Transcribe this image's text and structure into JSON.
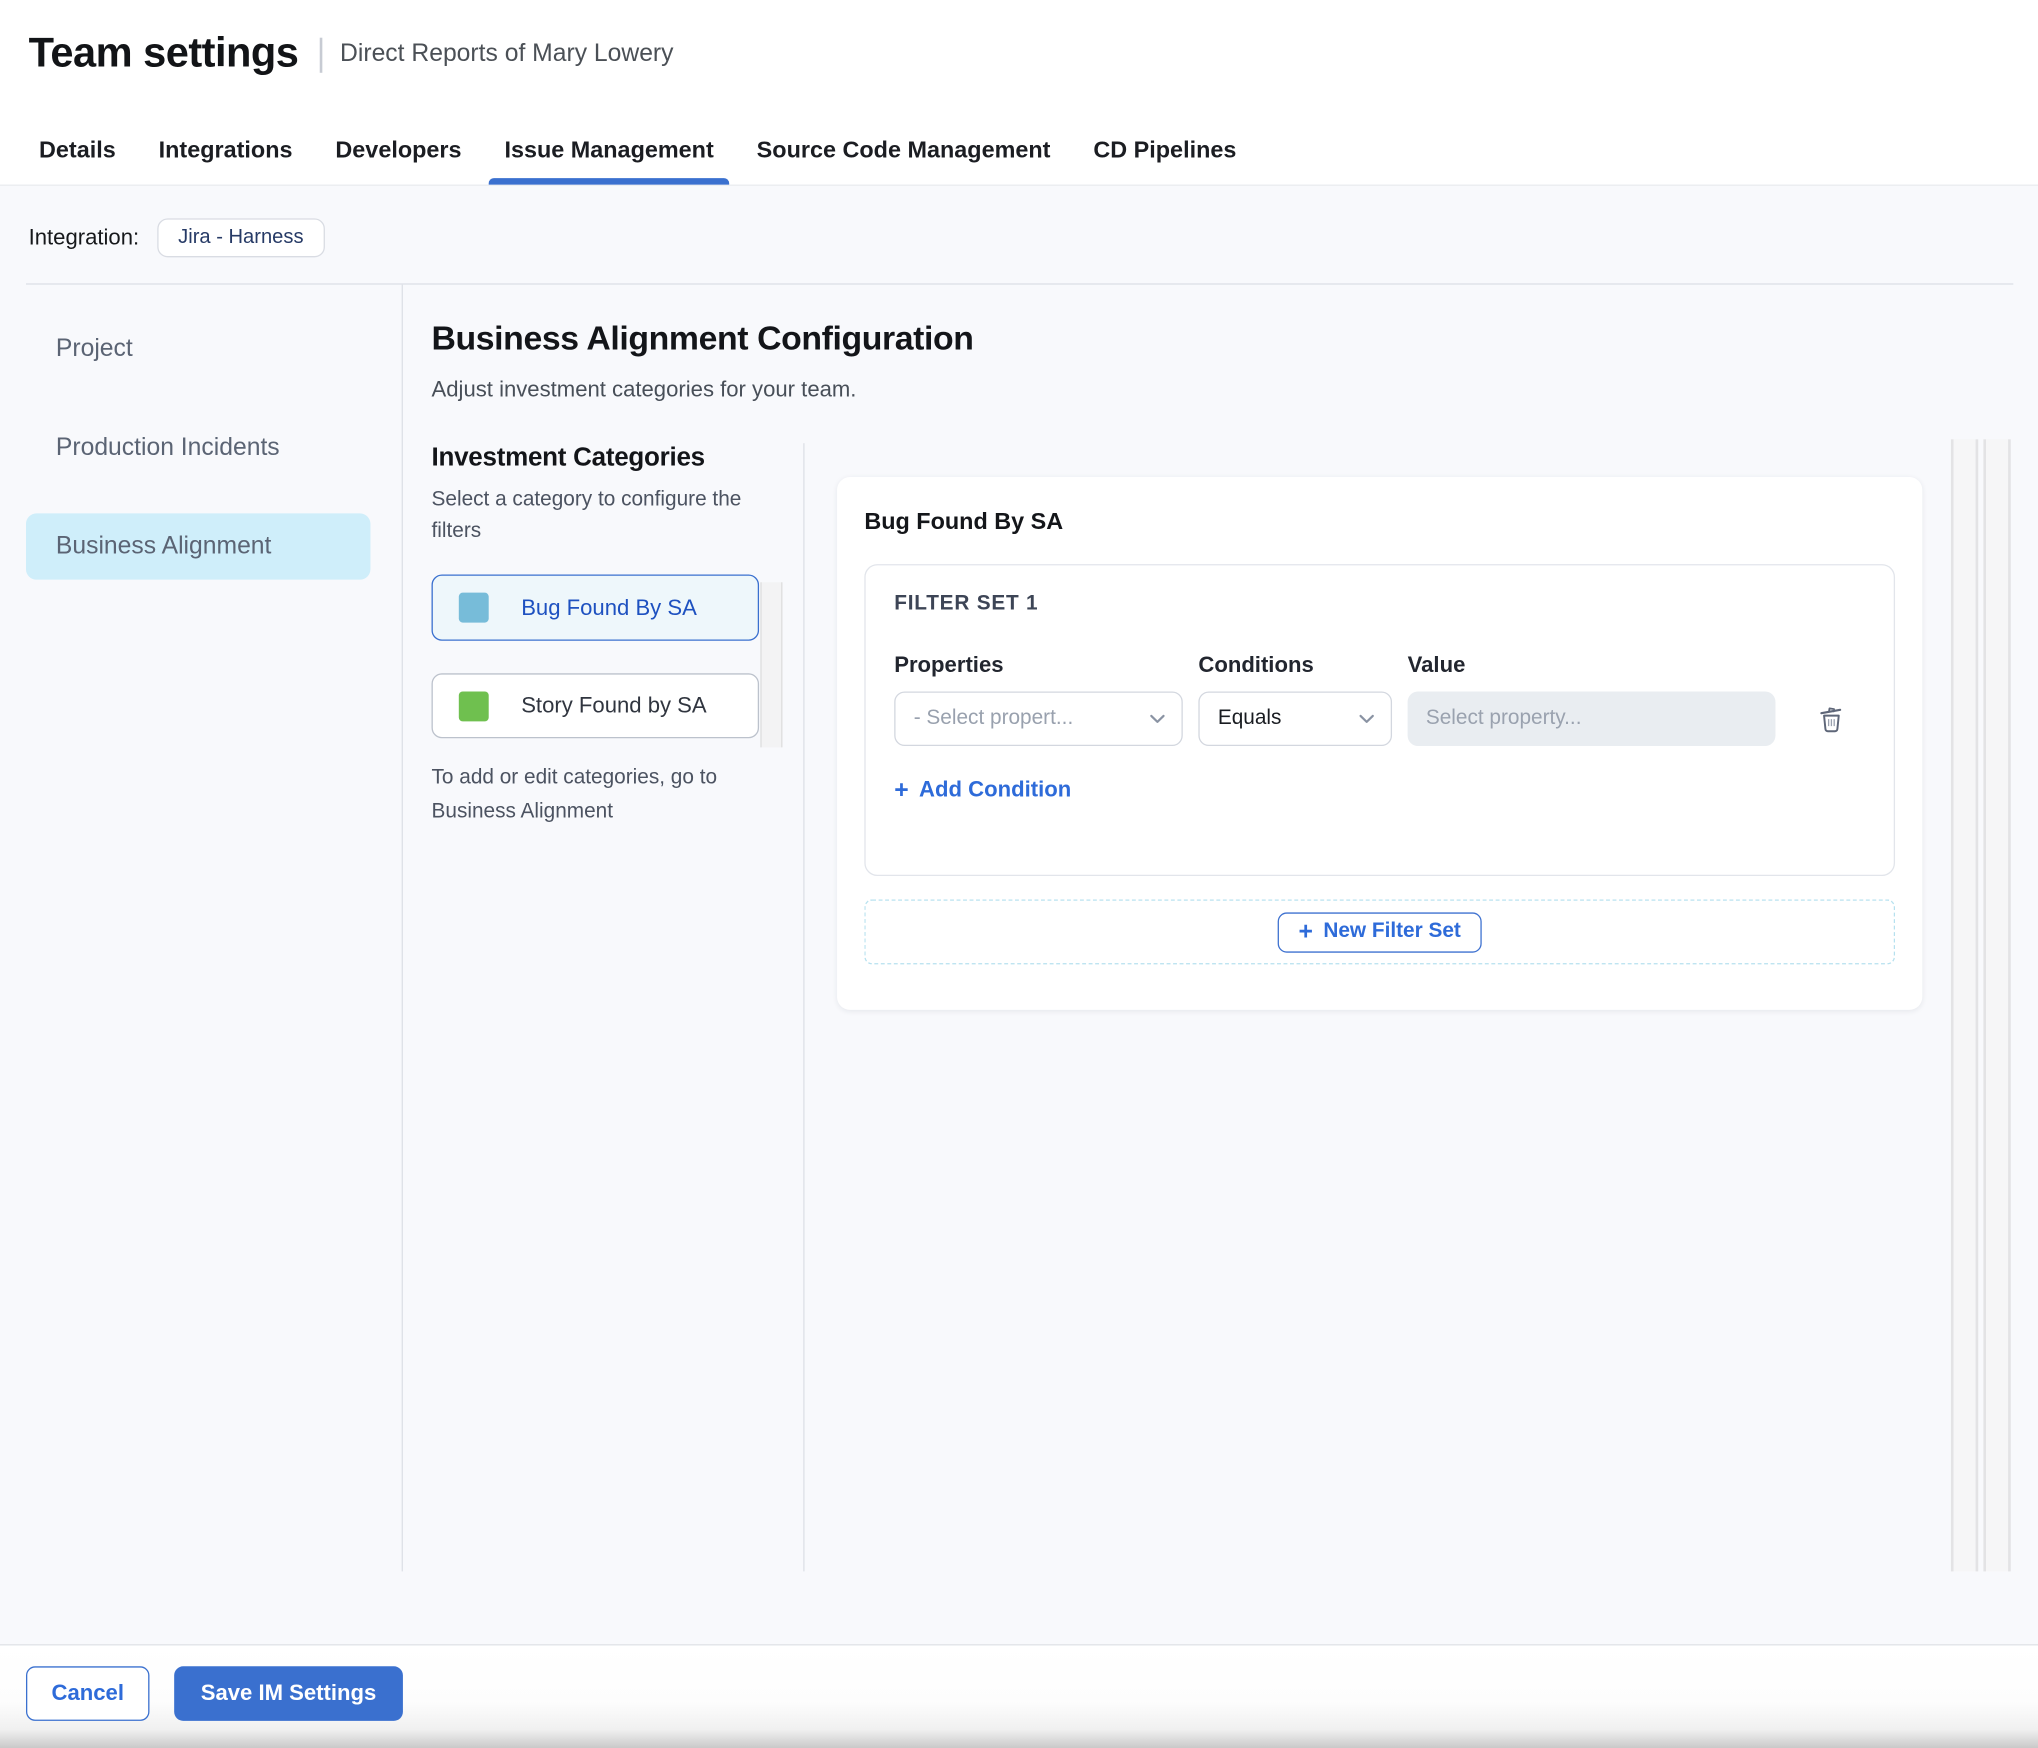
{
  "header": {
    "title": "Team settings",
    "subtitle": "Direct Reports of Mary Lowery"
  },
  "tabs": [
    {
      "label": "Details",
      "active": false
    },
    {
      "label": "Integrations",
      "active": false
    },
    {
      "label": "Developers",
      "active": false
    },
    {
      "label": "Issue Management",
      "active": true
    },
    {
      "label": "Source Code Management",
      "active": false
    },
    {
      "label": "CD Pipelines",
      "active": false
    }
  ],
  "integration": {
    "label": "Integration:",
    "value": "Jira - Harness"
  },
  "sidebar": {
    "items": [
      {
        "label": "Project",
        "active": false
      },
      {
        "label": "Production Incidents",
        "active": false
      },
      {
        "label": "Business Alignment",
        "active": true
      }
    ]
  },
  "main": {
    "title": "Business Alignment Configuration",
    "subtitle": "Adjust investment categories for your team.",
    "investment_categories": {
      "heading": "Investment Categories",
      "hint": "Select a category to configure the filters",
      "items": [
        {
          "label": "Bug Found By SA",
          "swatch_color": "#77bcd9",
          "selected": true
        },
        {
          "label": "Story Found by SA",
          "swatch_color": "#6fc04f",
          "selected": false
        }
      ],
      "footnote": "To add or edit categories, go to Business Alignment"
    },
    "config_panel": {
      "title": "Bug Found By SA",
      "filter_set": {
        "label": "FILTER SET 1",
        "columns": [
          "Properties",
          "Conditions",
          "Value"
        ],
        "property_select": {
          "placeholder": "- Select propert..."
        },
        "condition_select": {
          "value": "Equals"
        },
        "value_input": {
          "placeholder": "Select property..."
        },
        "add_condition_label": "Add Condition"
      },
      "new_filter_set_label": "New Filter Set"
    }
  },
  "footer": {
    "cancel_label": "Cancel",
    "save_label": "Save IM Settings"
  },
  "icons": {
    "plus": "+"
  },
  "colors": {
    "primary_blue": "#3a70cf",
    "link_blue": "#2e6bd9",
    "active_nav_bg": "#cfeefa",
    "selected_category_bg": "#eef7fb",
    "content_bg": "#f8f9fc",
    "bug_swatch": "#77bcd9",
    "story_swatch": "#6fc04f",
    "value_input_bg": "#e9edf1",
    "dashed_border": "#b6e1ef"
  }
}
